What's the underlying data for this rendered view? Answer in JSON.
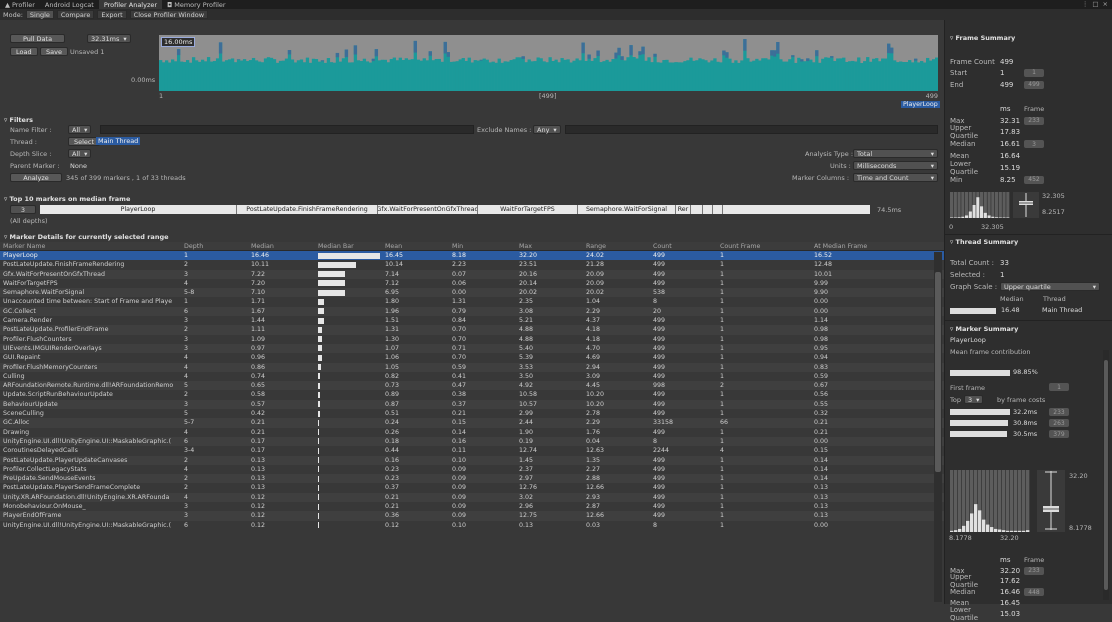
{
  "tabs": [
    {
      "label": "Profiler",
      "icon": "profiler-icon"
    },
    {
      "label": "Android Logcat"
    },
    {
      "label": "Profiler Analyzer",
      "active": true
    },
    {
      "label": "Memory Profiler",
      "icon": "camera-icon"
    }
  ],
  "window_controls": [
    "⋮",
    "□",
    "×"
  ],
  "modebar": {
    "mode_label": "Mode:",
    "single": "Single",
    "compare": "Compare",
    "export": "Export",
    "close": "Close Profiler Window"
  },
  "top": {
    "pull_data": "Pull Data",
    "scale_dropdown": "32.31ms",
    "load": "Load",
    "save": "Save",
    "unsaved": "Unsaved 1",
    "ms_top": "16.00ms",
    "ms_bottom": "0.00ms",
    "range_start": "1",
    "range_mid": "[499]",
    "range_end": "499",
    "range_tag": "PlayerLoop"
  },
  "filters": {
    "title": "Filters",
    "name_filter_label": "Name Filter :",
    "name_filter_value": "All",
    "exclude_label": "Exclude Names :",
    "exclude_value": "Any",
    "thread_label": "Thread :",
    "thread_button": "Select",
    "thread_value": "Main Thread",
    "depth_label": "Depth Slice :",
    "depth_value": "All",
    "parent_label": "Parent Marker :",
    "parent_value": "None",
    "analyze_button": "Analyze",
    "analyze_info": "345 of 399 markers , 1 of 33 threads",
    "analysis_type_label": "Analysis Type :",
    "analysis_type_value": "Total",
    "units_label": "Units :",
    "units_value": "Milliseconds",
    "marker_cols_label": "Marker Columns :",
    "marker_cols_value": "Time and Count"
  },
  "top10": {
    "title": "Top 10 markers on median frame",
    "depth": "3",
    "segments": [
      "PlayerLoop",
      "PostLateUpdate.FinishFrameRendering",
      "Gfx.WaitForPresentOnGfxThread",
      "WaitForTargetFPS",
      "Semaphore.WaitForSignal",
      "Rer"
    ],
    "total": "74.5ms",
    "all_depths": "(All depths)"
  },
  "marker_details": {
    "title": "Marker Details for currently selected range",
    "columns": [
      "Marker Name",
      "Depth",
      "Median",
      "Median Bar",
      "Mean",
      "Min",
      "Max",
      "Range",
      "Count",
      "Count Frame",
      "At Median Frame"
    ],
    "rows": [
      [
        "PlayerLoop",
        "1",
        "16.46",
        "100",
        "16.45",
        "8.18",
        "32.20",
        "24.02",
        "499",
        "1",
        "16.52"
      ],
      [
        "PostLateUpdate.FinishFrameRendering",
        "2",
        "10.11",
        "61",
        "10.14",
        "2.23",
        "23.51",
        "21.28",
        "499",
        "1",
        "12.48"
      ],
      [
        "Gfx.WaitForPresentOnGfxThread",
        "3",
        "7.22",
        "44",
        "7.14",
        "0.07",
        "20.16",
        "20.09",
        "499",
        "1",
        "10.01"
      ],
      [
        "WaitForTargetFPS",
        "4",
        "7.20",
        "44",
        "7.12",
        "0.06",
        "20.14",
        "20.09",
        "499",
        "1",
        "9.99"
      ],
      [
        "Semaphore.WaitForSignal",
        "5-8",
        "7.10",
        "43",
        "6.95",
        "0.00",
        "20.02",
        "20.02",
        "538",
        "1",
        "9.90"
      ],
      [
        "Unaccounted time between: Start of Frame and Playe",
        "1",
        "1.71",
        "10",
        "1.80",
        "1.31",
        "2.35",
        "1.04",
        "8",
        "1",
        "0.00"
      ],
      [
        "GC.Collect",
        "6",
        "1.67",
        "10",
        "1.96",
        "0.79",
        "3.08",
        "2.29",
        "20",
        "1",
        "0.00"
      ],
      [
        "Camera.Render",
        "3",
        "1.44",
        "9",
        "1.51",
        "0.84",
        "5.21",
        "4.37",
        "499",
        "1",
        "1.14"
      ],
      [
        "PostLateUpdate.ProfilerEndFrame",
        "2",
        "1.11",
        "7",
        "1.31",
        "0.70",
        "4.88",
        "4.18",
        "499",
        "1",
        "0.98"
      ],
      [
        "Profiler.FlushCounters",
        "3",
        "1.09",
        "7",
        "1.30",
        "0.70",
        "4.88",
        "4.18",
        "499",
        "1",
        "0.98"
      ],
      [
        "UIEvents.IMGUIRenderOverlays",
        "3",
        "0.97",
        "6",
        "1.07",
        "0.71",
        "5.40",
        "4.70",
        "499",
        "1",
        "0.95"
      ],
      [
        "GUI.Repaint",
        "4",
        "0.96",
        "6",
        "1.06",
        "0.70",
        "5.39",
        "4.69",
        "499",
        "1",
        "0.94"
      ],
      [
        "Profiler.FlushMemoryCounters",
        "4",
        "0.86",
        "5",
        "1.05",
        "0.59",
        "3.53",
        "2.94",
        "499",
        "1",
        "0.83"
      ],
      [
        "Culling",
        "4",
        "0.74",
        "4",
        "0.82",
        "0.41",
        "3.50",
        "3.09",
        "499",
        "1",
        "0.59"
      ],
      [
        "ARFoundationRemote.Runtime.dll!ARFoundationRemo",
        "5",
        "0.65",
        "4",
        "0.73",
        "0.47",
        "4.92",
        "4.45",
        "998",
        "2",
        "0.67"
      ],
      [
        "Update.ScriptRunBehaviourUpdate",
        "2",
        "0.58",
        "4",
        "0.89",
        "0.38",
        "10.58",
        "10.20",
        "499",
        "1",
        "0.56"
      ],
      [
        "BehaviourUpdate",
        "3",
        "0.57",
        "3",
        "0.87",
        "0.37",
        "10.57",
        "10.20",
        "499",
        "1",
        "0.55"
      ],
      [
        "SceneCulling",
        "5",
        "0.42",
        "3",
        "0.51",
        "0.21",
        "2.99",
        "2.78",
        "499",
        "1",
        "0.32"
      ],
      [
        "GC.Alloc",
        "5-7",
        "0.21",
        "1",
        "0.24",
        "0.15",
        "2.44",
        "2.29",
        "33158",
        "66",
        "0.21"
      ],
      [
        "Drawing",
        "4",
        "0.21",
        "1",
        "0.26",
        "0.14",
        "1.90",
        "1.76",
        "499",
        "1",
        "0.21"
      ],
      [
        "UnityEngine.UI.dll!UnityEngine.UI::MaskableGraphic.(",
        "6",
        "0.17",
        "1",
        "0.18",
        "0.16",
        "0.19",
        "0.04",
        "8",
        "1",
        "0.00"
      ],
      [
        "CoroutinesDelayedCalls",
        "3-4",
        "0.17",
        "1",
        "0.44",
        "0.11",
        "12.74",
        "12.63",
        "2244",
        "4",
        "0.15"
      ],
      [
        "PostLateUpdate.PlayerUpdateCanvases",
        "2",
        "0.13",
        "1",
        "0.16",
        "0.10",
        "1.45",
        "1.35",
        "499",
        "1",
        "0.14"
      ],
      [
        "Profiler.CollectLegacyStats",
        "4",
        "0.13",
        "1",
        "0.23",
        "0.09",
        "2.37",
        "2.27",
        "499",
        "1",
        "0.14"
      ],
      [
        "PreUpdate.SendMouseEvents",
        "2",
        "0.13",
        "1",
        "0.23",
        "0.09",
        "2.97",
        "2.88",
        "499",
        "1",
        "0.14"
      ],
      [
        "PostLateUpdate.PlayerSendFrameComplete",
        "2",
        "0.13",
        "1",
        "0.37",
        "0.09",
        "12.76",
        "12.66",
        "499",
        "1",
        "0.13"
      ],
      [
        "Unity.XR.ARFoundation.dll!UnityEngine.XR.ARFounda",
        "4",
        "0.12",
        "1",
        "0.21",
        "0.09",
        "3.02",
        "2.93",
        "499",
        "1",
        "0.13"
      ],
      [
        "Monobehaviour.OnMouse_",
        "3",
        "0.12",
        "1",
        "0.21",
        "0.09",
        "2.96",
        "2.87",
        "499",
        "1",
        "0.13"
      ],
      [
        "PlayerEndOfFrame",
        "3",
        "0.12",
        "1",
        "0.36",
        "0.09",
        "12.75",
        "12.66",
        "499",
        "1",
        "0.13"
      ],
      [
        "UnityEngine.UI.dll!UnityEngine.UI::MaskableGraphic.(",
        "6",
        "0.12",
        "1",
        "0.12",
        "0.10",
        "0.13",
        "0.03",
        "8",
        "1",
        "0.00"
      ]
    ]
  },
  "frame_summary": {
    "title": "Frame Summary",
    "frame_count_label": "Frame Count",
    "frame_count": "499",
    "start_label": "Start",
    "start": "1",
    "start_box": "1",
    "end_label": "End",
    "end": "499",
    "end_box": "499",
    "col_ms": "ms",
    "col_frame": "Frame",
    "stats": [
      {
        "label": "Max",
        "ms": "32.31",
        "frame": "233"
      },
      {
        "label": "Upper Quartile",
        "ms": "17.83",
        "frame": ""
      },
      {
        "label": "Median",
        "ms": "16.61",
        "frame": "3"
      },
      {
        "label": "Mean",
        "ms": "16.64",
        "frame": ""
      },
      {
        "label": "Lower Quartile",
        "ms": "15.19",
        "frame": ""
      },
      {
        "label": "Min",
        "ms": "8.25",
        "frame": "452"
      }
    ],
    "hist_max": "32.305",
    "hist_min": "8.2517",
    "axis_left": "0",
    "axis_right": "32.305"
  },
  "thread_summary": {
    "title": "Thread Summary",
    "total_count_label": "Total Count :",
    "total_count": "33",
    "selected_label": "Selected :",
    "selected": "1",
    "graph_scale_label": "Graph Scale :",
    "graph_scale": "Upper quartile",
    "col_median": "Median",
    "col_thread": "Thread",
    "median": "16.48",
    "thread": "Main Thread"
  },
  "marker_summary": {
    "title": "Marker Summary",
    "marker": "PlayerLoop",
    "subtitle": "Mean frame contribution",
    "contribution": "98.85%",
    "first_frame_label": "First frame",
    "first_frame": "1",
    "top_label": "Top",
    "top_value": "3",
    "by_costs": "by frame costs",
    "top_frames": [
      {
        "ms": "32.2ms",
        "frame": "233",
        "pct": 100
      },
      {
        "ms": "30.8ms",
        "frame": "263",
        "pct": 96
      },
      {
        "ms": "30.5ms",
        "frame": "379",
        "pct": 95
      }
    ],
    "hist_max": "32.20",
    "hist_min": "8.1778",
    "axis_left": "8.1778",
    "axis_right": "32.20",
    "col_ms": "ms",
    "col_frame": "Frame",
    "stats": [
      {
        "label": "Max",
        "ms": "32.20",
        "frame": "233"
      },
      {
        "label": "Upper Quartile",
        "ms": "17.62",
        "frame": ""
      },
      {
        "label": "Median",
        "ms": "16.46",
        "frame": "448"
      },
      {
        "label": "Mean",
        "ms": "16.45",
        "frame": ""
      },
      {
        "label": "Lower Quartile",
        "ms": "15.03",
        "frame": ""
      }
    ]
  },
  "colors": {
    "accent": "#2b5ba1",
    "graph_fill": "#1b9a9a",
    "graph_bg": "#8f8f8f"
  }
}
